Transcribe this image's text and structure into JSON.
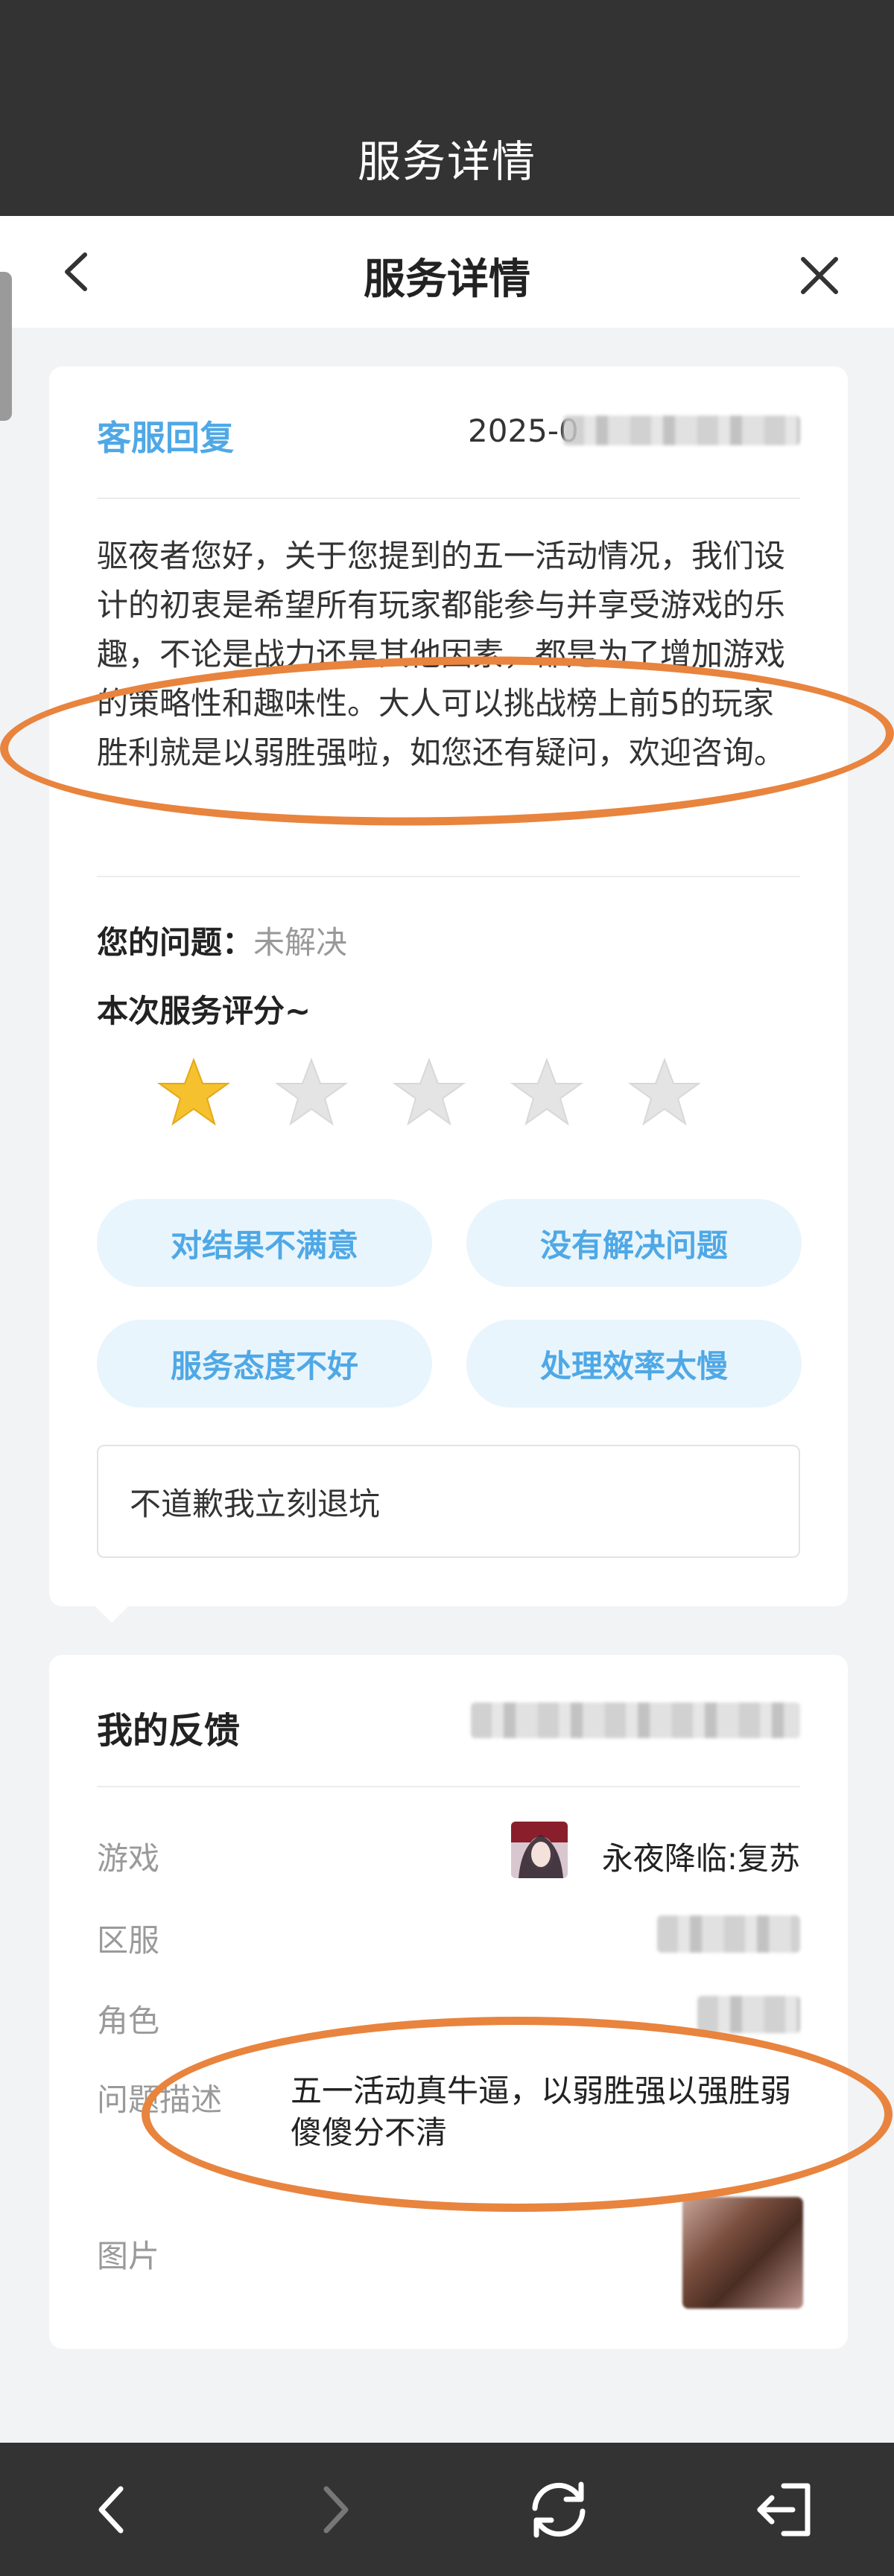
{
  "top_bar": {
    "title": "服务详情"
  },
  "nav": {
    "title": "服务详情"
  },
  "reply_card": {
    "title": "客服回复",
    "date_visible": "2025-0",
    "body": "驱夜者您好，关于您提到的五一活动情况，我们设计的初衷是希望所有玩家都能参与并享受游戏的乐趣，不论是战力还是其他因素，都是为了增加游戏的策略性和趣味性。大人可以挑战榜上前5的玩家胜利就是以弱胜强啦，如您还有疑问，欢迎咨询。",
    "question_label": "您的问题：",
    "question_status": "未解决",
    "rating_label": "本次服务评分~",
    "rating": 1,
    "rating_max": 5,
    "chips": [
      "对结果不满意",
      "没有解决问题",
      "服务态度不好",
      "处理效率太慢"
    ],
    "comment": "不道歉我立刻退坑"
  },
  "feedback_card": {
    "title": "我的反馈",
    "rows": {
      "game_label": "游戏",
      "game_value": "永夜降临:复苏",
      "server_label": "区服",
      "role_label": "角色",
      "desc_label": "问题描述",
      "desc_value": "五一活动真牛逼，以弱胜强以强胜弱傻傻分不清",
      "image_label": "图片"
    }
  },
  "colors": {
    "accent": "#4fa8e6",
    "chip_bg": "#e9f5fc",
    "annotation": "#e8843e",
    "star_active": "#f5c12e",
    "bar_bg": "#333333"
  },
  "icons": {
    "nav_back": "chevron-left-icon",
    "nav_close": "close-icon",
    "browser_back": "chevron-left-icon",
    "browser_forward": "chevron-right-icon",
    "refresh": "refresh-icon",
    "exit": "exit-icon"
  }
}
